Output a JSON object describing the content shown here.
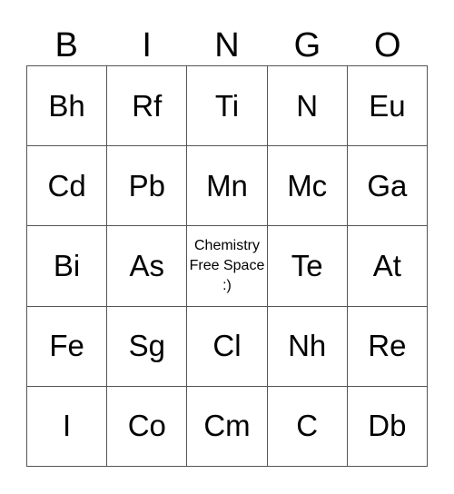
{
  "header": [
    "B",
    "I",
    "N",
    "G",
    "O"
  ],
  "cells": [
    [
      "Bh",
      "Rf",
      "Ti",
      "N",
      "Eu"
    ],
    [
      "Cd",
      "Pb",
      "Mn",
      "Mc",
      "Ga"
    ],
    [
      "Bi",
      "As",
      "Chemistry Free Space :)",
      "Te",
      "At"
    ],
    [
      "Fe",
      "Sg",
      "Cl",
      "Nh",
      "Re"
    ],
    [
      "I",
      "Co",
      "Cm",
      "C",
      "Db"
    ]
  ],
  "free_space": {
    "row": 2,
    "col": 2
  }
}
